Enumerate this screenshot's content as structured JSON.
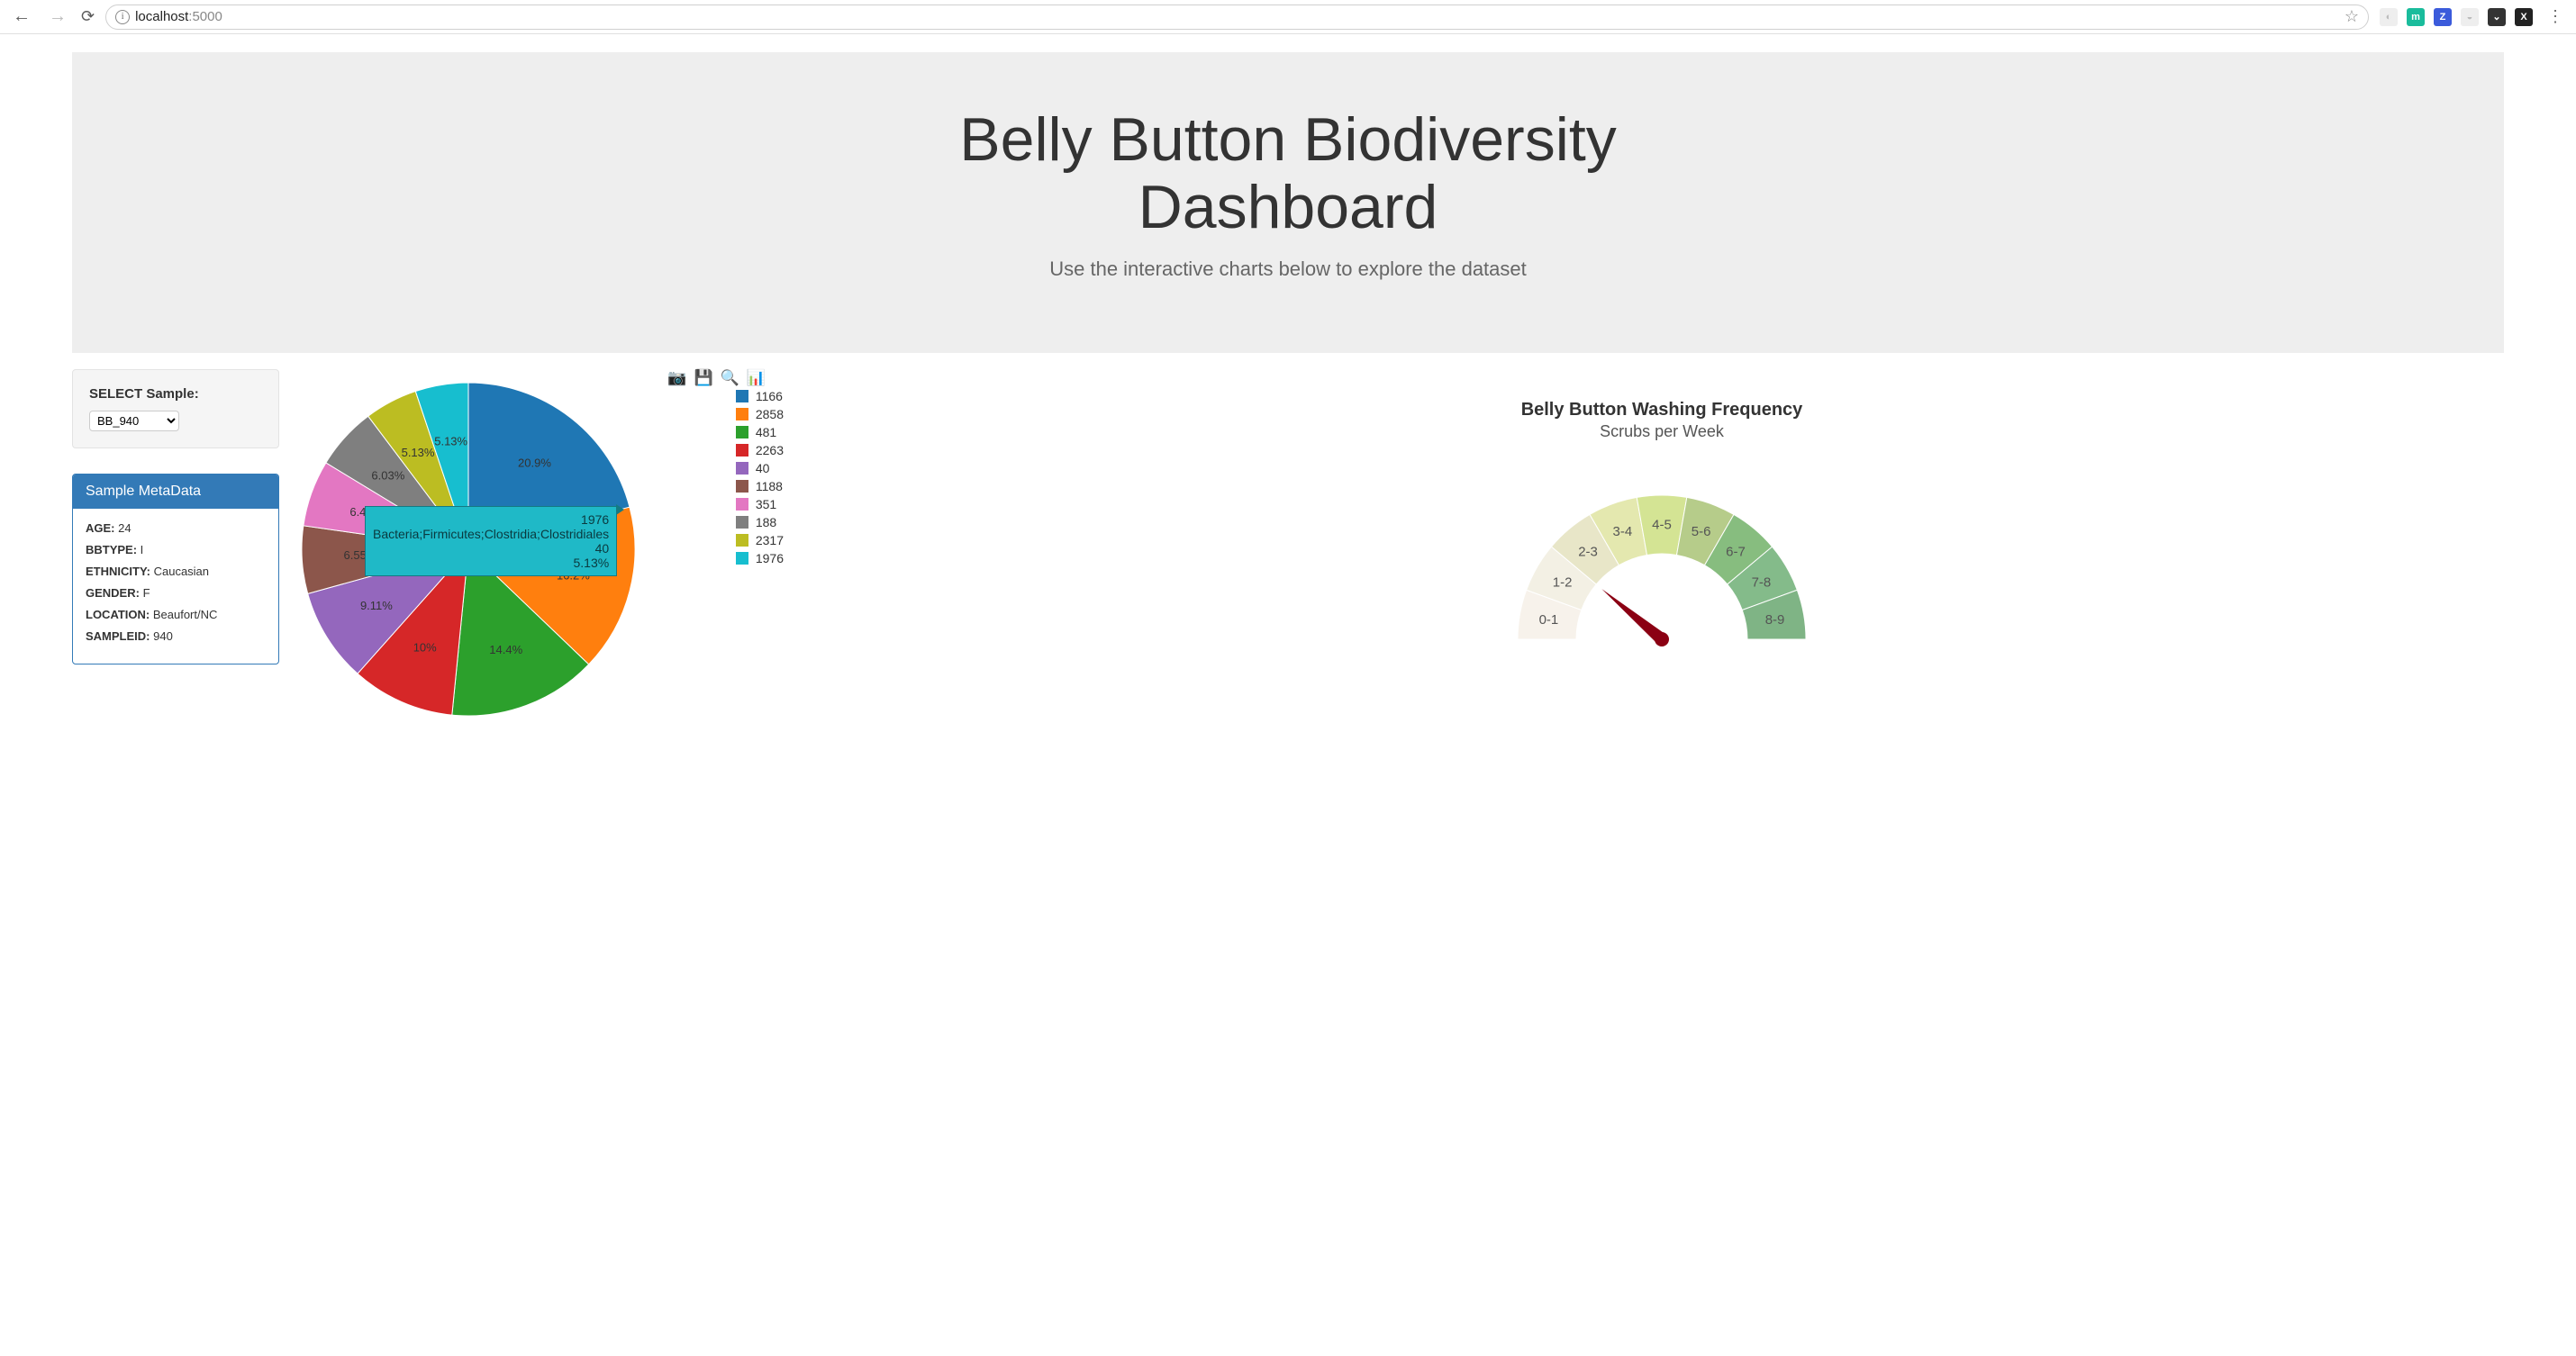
{
  "browser": {
    "url_host": "localhost",
    "url_port": ":5000"
  },
  "hero": {
    "title_l1": "Belly Button Biodiversity",
    "title_l2": "Dashboard",
    "subtitle": "Use the interactive charts below to explore the dataset"
  },
  "selector": {
    "label": "SELECT Sample:",
    "value": "BB_940"
  },
  "metadata": {
    "title": "Sample MetaData",
    "items": [
      {
        "k": "AGE:",
        "v": "24"
      },
      {
        "k": "BBTYPE:",
        "v": "I"
      },
      {
        "k": "ETHNICITY:",
        "v": "Caucasian"
      },
      {
        "k": "GENDER:",
        "v": "F"
      },
      {
        "k": "LOCATION:",
        "v": "Beaufort/NC"
      },
      {
        "k": "SAMPLEID:",
        "v": "940"
      }
    ]
  },
  "pie_tooltip": {
    "line1": "1976",
    "line2": "Bacteria;Firmicutes;Clostridia;Clostridiales",
    "line3": "40",
    "line4": "5.13%"
  },
  "gauge": {
    "title": "Belly Button Washing Frequency",
    "subtitle": "Scrubs per Week"
  },
  "chart_data": [
    {
      "type": "pie",
      "title": "",
      "series": [
        {
          "id": "1166",
          "value": 20.9,
          "label": "20.9%",
          "color": "#1f77b4"
        },
        {
          "id": "2858",
          "value": 16.2,
          "label": "16.2%",
          "color": "#ff7f0e"
        },
        {
          "id": "481",
          "value": 14.4,
          "label": "14.4%",
          "color": "#2ca02c"
        },
        {
          "id": "2263",
          "value": 10.0,
          "label": "10%",
          "color": "#d62728"
        },
        {
          "id": "40",
          "value": 9.11,
          "label": "9.11%",
          "color": "#9467bd"
        },
        {
          "id": "1188",
          "value": 6.55,
          "label": "6.55%",
          "color": "#8c564b"
        },
        {
          "id": "351",
          "value": 6.42,
          "label": "6.42%",
          "color": "#e377c2"
        },
        {
          "id": "188",
          "value": 6.03,
          "label": "6.03%",
          "color": "#7f7f7f"
        },
        {
          "id": "2317",
          "value": 5.13,
          "label": "5.13%",
          "color": "#bcbd22"
        },
        {
          "id": "1976",
          "value": 5.13,
          "label": "5.13%",
          "color": "#17becf"
        }
      ],
      "legend": [
        "1166",
        "2858",
        "481",
        "2263",
        "40",
        "1188",
        "351",
        "188",
        "2317",
        "1976"
      ]
    },
    {
      "type": "gauge",
      "title": "Belly Button Washing Frequency",
      "subtitle": "Scrubs per Week",
      "range": [
        0,
        9
      ],
      "value": 2,
      "steps": [
        {
          "label": "0-1",
          "color": "#f7f2eb"
        },
        {
          "label": "1-2",
          "color": "#f3f0e4"
        },
        {
          "label": "2-3",
          "color": "#e8e6c8"
        },
        {
          "label": "3-4",
          "color": "#e4e8af"
        },
        {
          "label": "4-5",
          "color": "#d4e494"
        },
        {
          "label": "5-6",
          "color": "#b6cc8a"
        },
        {
          "label": "6-7",
          "color": "#87bd7f"
        },
        {
          "label": "7-8",
          "color": "#84bb8a"
        },
        {
          "label": "8-9",
          "color": "#7fb485"
        }
      ]
    }
  ]
}
